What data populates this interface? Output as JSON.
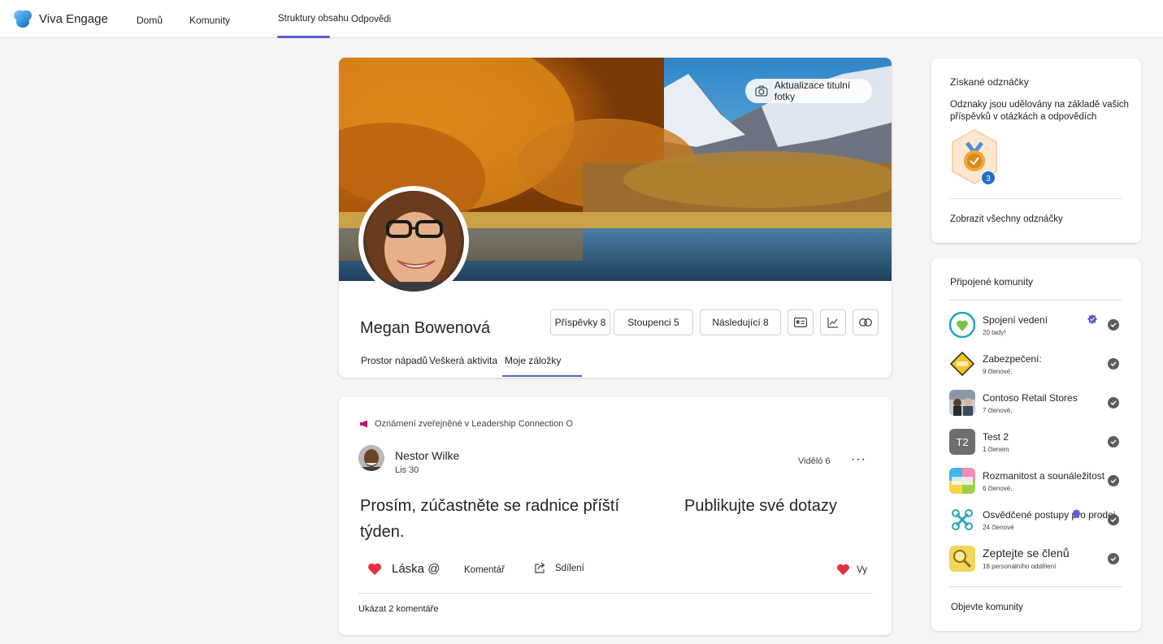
{
  "app": {
    "name": "Viva Engage"
  },
  "nav": {
    "home": "Domů",
    "communities": "Komunity",
    "storylines": "Struktury obsahu",
    "answers": "Odpovědi"
  },
  "profile": {
    "cover_button": "Aktualizace titulní fotky",
    "name": "Megan Bowenová",
    "stats": {
      "posts": "Příspěvky 8",
      "followers": "Stoupenci 5",
      "following": "Následující 8"
    },
    "tabs": [
      "Prostor nápadů",
      "Veškerá aktivita",
      "Moje záložky"
    ]
  },
  "post": {
    "announcement": "Oznámení zveřejněné v Leadership Connection O",
    "author": "Nestor Wilke",
    "date": "Lis 30",
    "seen": "Viděló 6",
    "body": "Prosím, zúčastněte se radnice příští týden.",
    "body_right": "Publikujte své dotazy",
    "actions": {
      "love": "Láska @",
      "comment": "Komentář",
      "share": "Sdílení",
      "reacted": "Vy"
    },
    "show_comments": "Ukázat 2 komentáře"
  },
  "badges": {
    "title": "Získané odznáčky",
    "description": "Odznaky jsou udělovány na základě vašich příspěvků v otázkách a odpovědích",
    "count": "3",
    "view_all": "Zobrazit všechny odznáčky"
  },
  "communities": {
    "title": "Připojené komunity",
    "items": [
      {
        "name": "Spojení vedení",
        "sub": "20 tady!"
      },
      {
        "name": "Zabezpečení:",
        "sub": "9 členové,"
      },
      {
        "name": "Contoso Retail Stores",
        "sub": "7 členové,"
      },
      {
        "name": "Test 2",
        "sub": "1 členem",
        "initials": "T2"
      },
      {
        "name": "Rozmanitost a sounáležitost",
        "sub": "6 členové,"
      },
      {
        "name": "Osvědčené postupy pro prodej",
        "sub": "24 členové"
      },
      {
        "name": "Zeptejte se členů",
        "sub": "16 personálního oddělení"
      }
    ],
    "discover": "Objevte komunity"
  },
  "colors": {
    "accent": "#5b5fc7",
    "heart": "#e3323b",
    "announcement": "#c4126a"
  }
}
